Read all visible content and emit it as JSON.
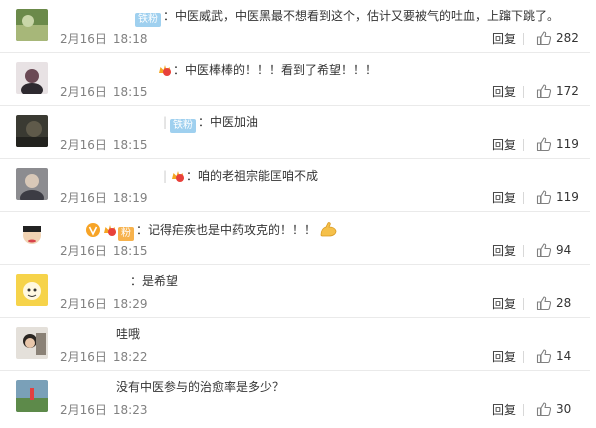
{
  "comments": [
    {
      "badge": "铁粉",
      "text": "：中医威武，中医黑最不想看到这个，估计又要被气的吐血，上蹿下跳了。",
      "date": "2月16日",
      "time": "18:18",
      "reply": "回复",
      "likes": "282"
    },
    {
      "badge": "",
      "text": "：中医棒棒的！！！看到了希望！！！",
      "date": "2月16日",
      "time": "18:15",
      "reply": "回复",
      "likes": "172"
    },
    {
      "badge": "铁粉",
      "text": "：中医加油",
      "date": "2月16日",
      "time": "18:15",
      "reply": "回复",
      "likes": "119"
    },
    {
      "badge": "",
      "text": "：咱的老祖宗能匡咱不成",
      "date": "2月16日",
      "time": "18:19",
      "reply": "回复",
      "likes": "119"
    },
    {
      "badge": "粉",
      "text": "：记得疟疾也是中药攻克的！！！",
      "date": "2月16日",
      "time": "18:15",
      "reply": "回复",
      "likes": "94"
    },
    {
      "badge": "",
      "text": "：是希望",
      "date": "2月16日",
      "time": "18:29",
      "reply": "回复",
      "likes": "28"
    },
    {
      "badge": "",
      "text": "哇哦",
      "date": "2月16日",
      "time": "18:22",
      "reply": "回复",
      "likes": "14"
    },
    {
      "badge": "",
      "text": "没有中医参与的治愈率是多少？",
      "date": "2月16日",
      "time": "18:23",
      "reply": "回复",
      "likes": "30"
    }
  ],
  "colors": {
    "fan_badge": "#9fd0ef",
    "gold_badge": "#f7b24c",
    "meta_text": "#808080",
    "divider": "#eaeaea"
  },
  "icons": [
    "like-thumb-icon",
    "crown-icon",
    "vip-v-icon",
    "flexed-arm-emoji"
  ]
}
